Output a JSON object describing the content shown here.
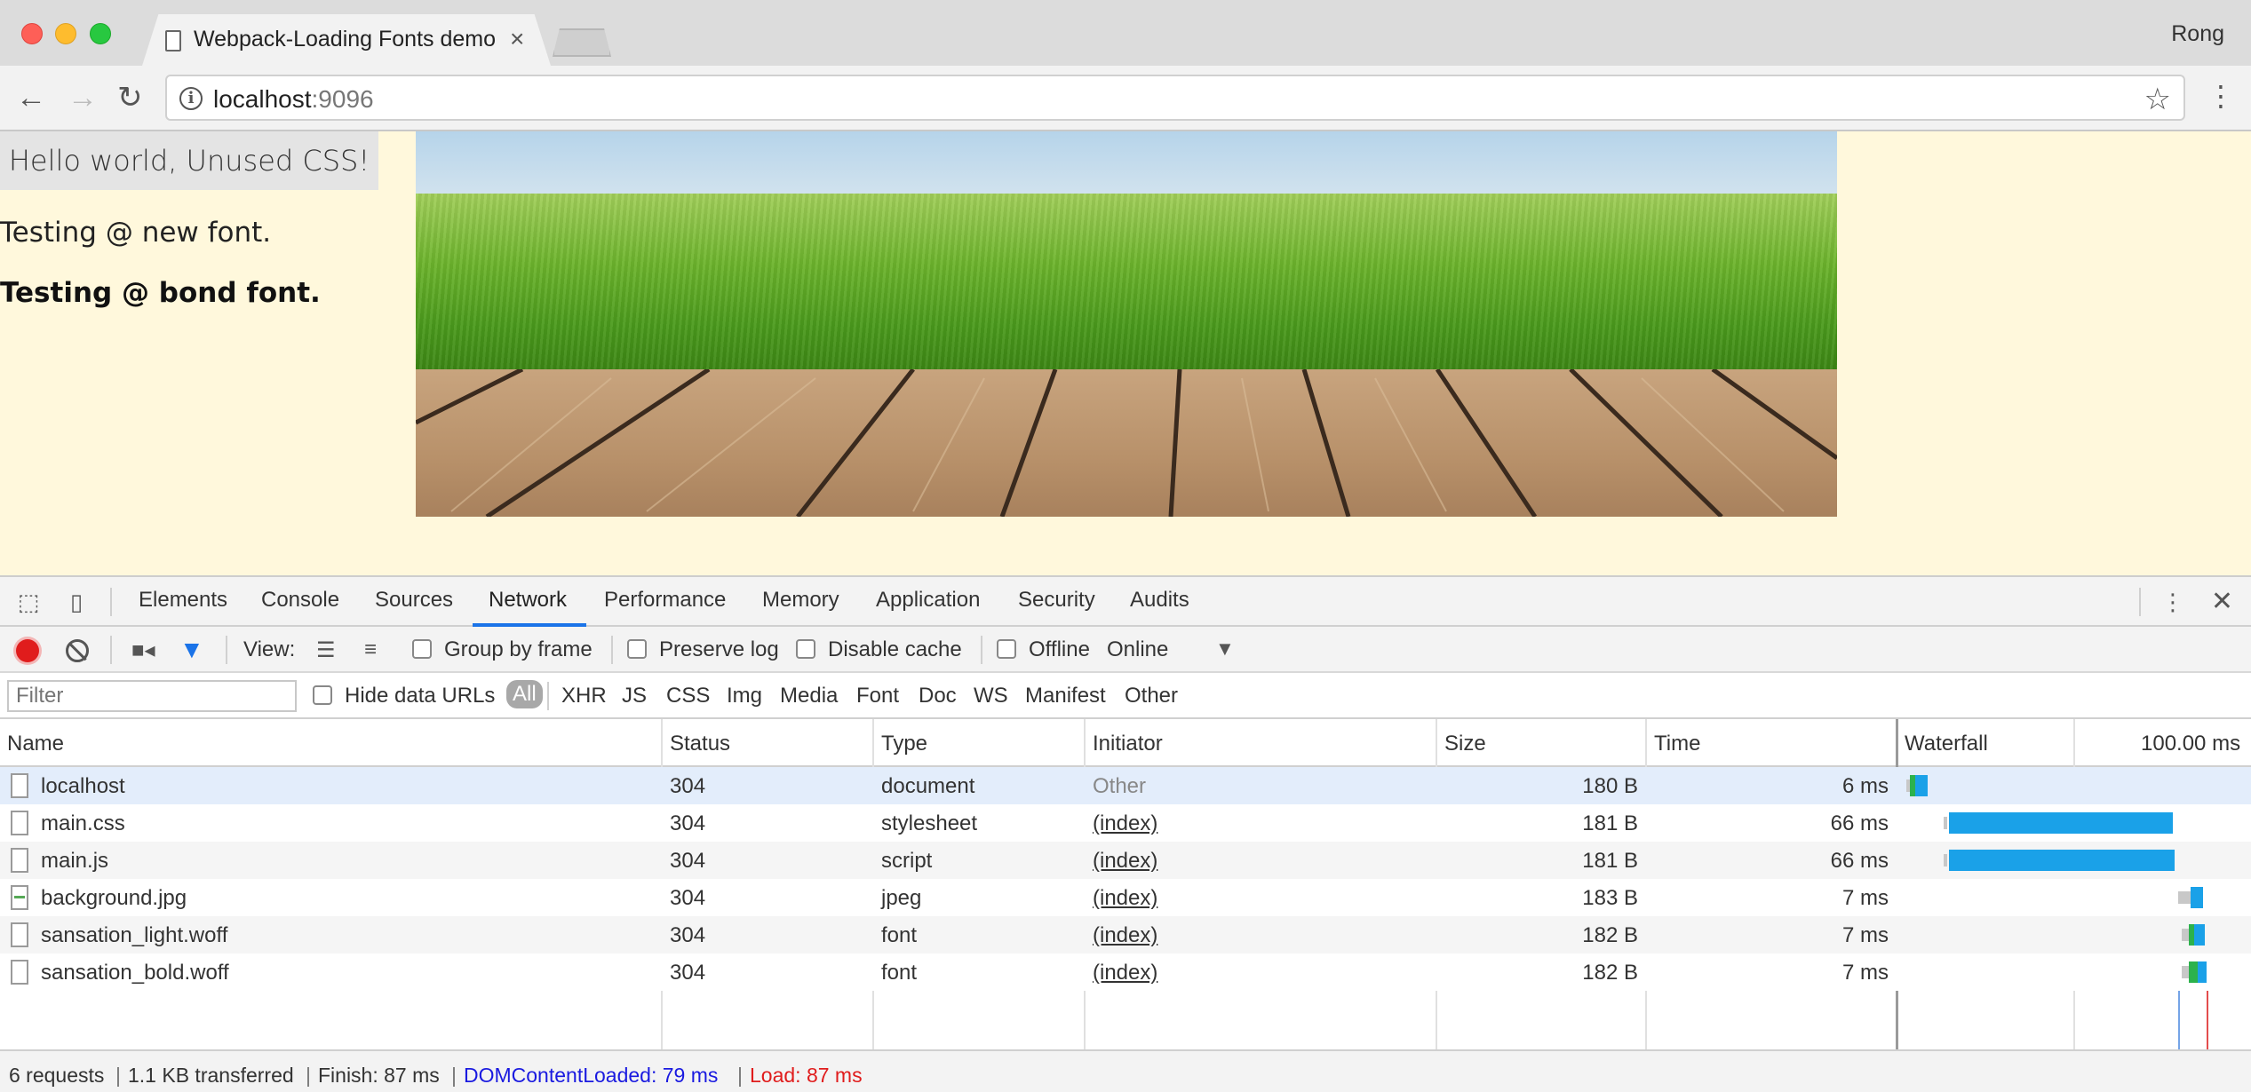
{
  "browser": {
    "tab_title": "Webpack-Loading Fonts demo",
    "profile": "Rong",
    "url_host": "localhost",
    "url_port": ":9096"
  },
  "page": {
    "button_label": "Hello world, Unused CSS!",
    "text_light": "Testing @ new font.",
    "text_bold": "Testing @ bond font."
  },
  "devtools": {
    "tabs": [
      "Elements",
      "Console",
      "Sources",
      "Network",
      "Performance",
      "Memory",
      "Application",
      "Security",
      "Audits"
    ],
    "active_tab": "Network",
    "controls": {
      "view_label": "View:",
      "group_by_frame": "Group by frame",
      "preserve_log": "Preserve log",
      "disable_cache": "Disable cache",
      "offline": "Offline",
      "throttle": "Online"
    },
    "filter": {
      "placeholder": "Filter",
      "hide_data_urls": "Hide data URLs",
      "types": [
        "All",
        "XHR",
        "JS",
        "CSS",
        "Img",
        "Media",
        "Font",
        "Doc",
        "WS",
        "Manifest",
        "Other"
      ],
      "active_type": "All"
    },
    "columns": [
      "Name",
      "Status",
      "Type",
      "Initiator",
      "Size",
      "Time",
      "Waterfall"
    ],
    "waterfall_scale": "100.00 ms",
    "rows": [
      {
        "name": "localhost",
        "status": "304",
        "type": "document",
        "initiator": "Other",
        "size": "180 B",
        "time": "6 ms"
      },
      {
        "name": "main.css",
        "status": "304",
        "type": "stylesheet",
        "initiator": "(index)",
        "size": "181 B",
        "time": "66 ms"
      },
      {
        "name": "main.js",
        "status": "304",
        "type": "script",
        "initiator": "(index)",
        "size": "181 B",
        "time": "66 ms"
      },
      {
        "name": "background.jpg",
        "status": "304",
        "type": "jpeg",
        "initiator": "(index)",
        "size": "183 B",
        "time": "7 ms"
      },
      {
        "name": "sansation_light.woff",
        "status": "304",
        "type": "font",
        "initiator": "(index)",
        "size": "182 B",
        "time": "7 ms"
      },
      {
        "name": "sansation_bold.woff",
        "status": "304",
        "type": "font",
        "initiator": "(index)",
        "size": "182 B",
        "time": "7 ms"
      }
    ],
    "summary": {
      "requests": "6 requests",
      "transferred": "1.1 KB transferred",
      "finish": "Finish: 87 ms",
      "dom_content_loaded": "DOMContentLoaded: 79 ms",
      "load": "Load: 87 ms"
    },
    "colors": {
      "dom_content_loaded": "#1a1ae0",
      "load": "#e01c1c",
      "waterfall_bar": "#1aa1e8",
      "active_tab_underline": "#1a73e8"
    }
  }
}
